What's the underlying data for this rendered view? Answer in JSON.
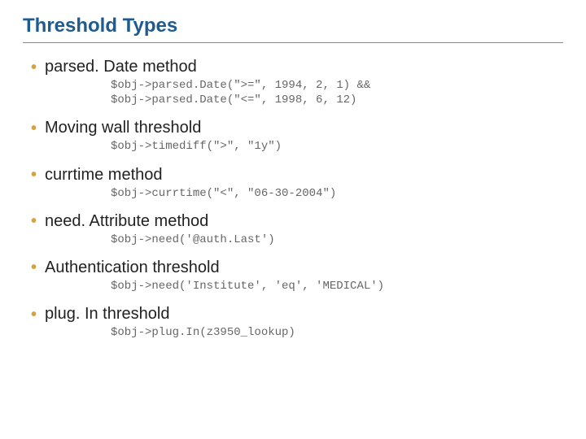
{
  "title": "Threshold Types",
  "items": [
    {
      "heading": "parsed. Date method",
      "code": "$obj->parsed.Date(\">=\", 1994, 2, 1) &&\n$obj->parsed.Date(\"<=\", 1998, 6, 12)"
    },
    {
      "heading": "Moving wall threshold",
      "code": "$obj->timediff(\">\", \"1y\")"
    },
    {
      "heading": "currtime method",
      "code": "$obj->currtime(\"<\", \"06-30-2004\")"
    },
    {
      "heading": "need. Attribute method",
      "code": "$obj->need('@auth.Last')"
    },
    {
      "heading": "Authentication threshold",
      "code": "$obj->need('Institute', 'eq', 'MEDICAL')"
    },
    {
      "heading": "plug. In threshold",
      "code": "$obj->plug.In(z3950_lookup)"
    }
  ]
}
